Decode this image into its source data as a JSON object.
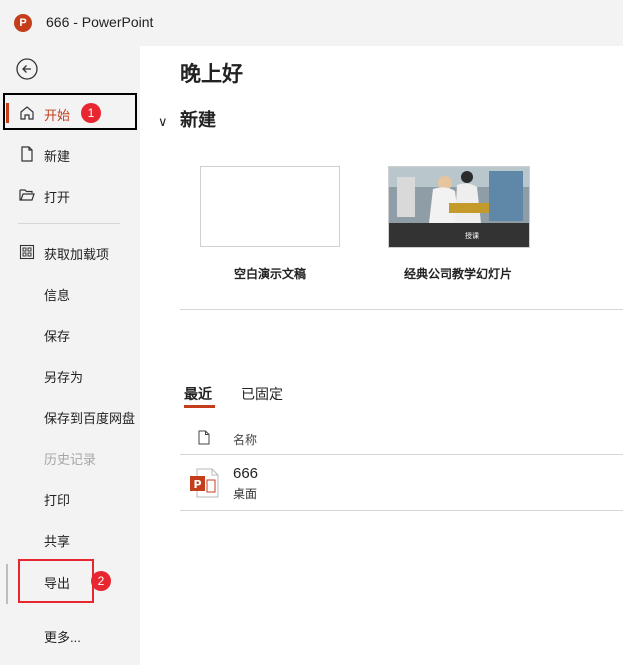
{
  "window": {
    "app_icon_letter": "P",
    "title": "666  -  PowerPoint"
  },
  "sidebar": {
    "items": [
      {
        "key": "home",
        "label": "开始"
      },
      {
        "key": "new",
        "label": "新建"
      },
      {
        "key": "open",
        "label": "打开"
      },
      {
        "key": "addins",
        "label": "获取加载项"
      },
      {
        "key": "info",
        "label": "信息"
      },
      {
        "key": "save",
        "label": "保存"
      },
      {
        "key": "saveas",
        "label": "另存为"
      },
      {
        "key": "save_baidu",
        "label": "保存到百度网盘"
      },
      {
        "key": "history",
        "label": "历史记录"
      },
      {
        "key": "print",
        "label": "打印"
      },
      {
        "key": "share",
        "label": "共享"
      },
      {
        "key": "export",
        "label": "导出"
      },
      {
        "key": "more",
        "label": "更多..."
      }
    ],
    "active": "开始",
    "disabled": "历史记录"
  },
  "annotations": {
    "badge1": "1",
    "badge2": "2"
  },
  "main": {
    "greeting": "晚上好",
    "new_section": "新建",
    "templates": [
      {
        "label": "空白演示文稿"
      },
      {
        "label": "经典公司教学幻灯片",
        "overlay_text": "授课"
      }
    ],
    "tabs": [
      {
        "label": "最近"
      },
      {
        "label": "已固定"
      }
    ],
    "list_header": "名称",
    "files": [
      {
        "name": "666",
        "location": "桌面"
      }
    ]
  },
  "colors": {
    "accent": "#c43e1c",
    "badge": "#e8262f",
    "sidebar_bg": "#f3f3f3"
  }
}
